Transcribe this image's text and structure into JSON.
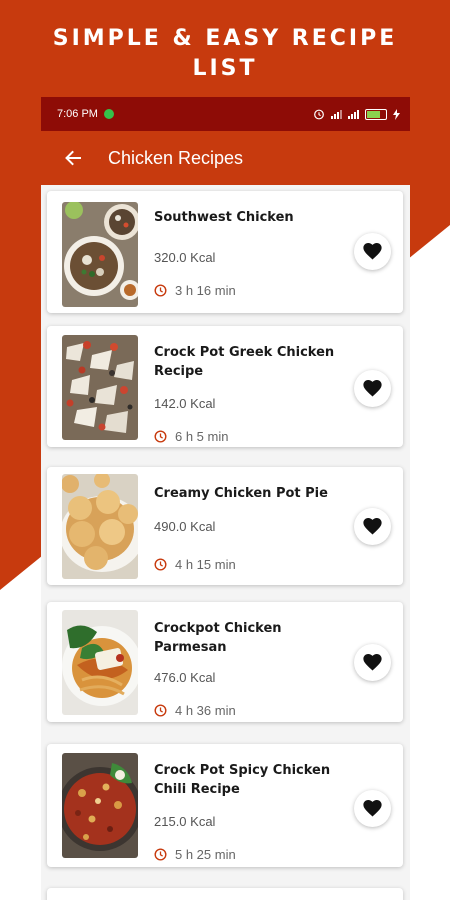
{
  "promo": {
    "title_line1": "SIMPLE & EASY RECIPE",
    "title_line2": "LIST"
  },
  "status_bar": {
    "time": "7:06 PM",
    "icons": [
      "alarm-icon",
      "signal-icon",
      "signal-icon",
      "battery-icon",
      "charging-icon"
    ]
  },
  "app_bar": {
    "title": "Chicken Recipes",
    "back_icon": "arrow-left-icon"
  },
  "colors": {
    "brand": "#c73a0e",
    "status_bar": "#8e0c06",
    "clock_icon": "#c73a0e"
  },
  "recipes": [
    {
      "name": "Southwest Chicken",
      "kcal": "320.0 Kcal",
      "time": "3 h 16 min",
      "favorite_icon": "heart-icon"
    },
    {
      "name": "Crock Pot Greek Chicken Recipe",
      "kcal": "142.0 Kcal",
      "time": "6 h 5 min",
      "favorite_icon": "heart-icon"
    },
    {
      "name": "Creamy Chicken Pot Pie",
      "kcal": "490.0 Kcal",
      "time": "4 h 15 min",
      "favorite_icon": "heart-icon"
    },
    {
      "name": "Crockpot Chicken Parmesan",
      "kcal": "476.0 Kcal",
      "time": "4 h 36 min",
      "favorite_icon": "heart-icon"
    },
    {
      "name": "Crock Pot Spicy Chicken Chili Recipe",
      "kcal": "215.0 Kcal",
      "time": "5 h 25 min",
      "favorite_icon": "heart-icon"
    }
  ]
}
